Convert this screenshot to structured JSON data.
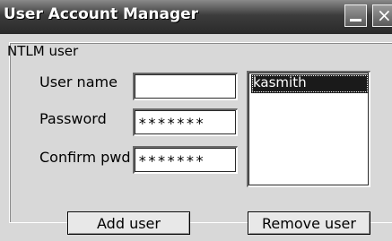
{
  "window": {
    "title": "User Account Manager",
    "minimize_icon": "minimize-icon",
    "close_icon": "close-icon",
    "close_glyph": "×"
  },
  "group": {
    "title": "NTLM user"
  },
  "form": {
    "username_label": "User name",
    "username_value": "",
    "password_label": "Password",
    "password_value": "*******",
    "confirm_label": "Confirm pwd",
    "confirm_value": "*******"
  },
  "users_list": {
    "items": [
      "kasmith"
    ],
    "selected": "kasmith"
  },
  "buttons": {
    "add_label": "Add user",
    "remove_label": "Remove user"
  }
}
